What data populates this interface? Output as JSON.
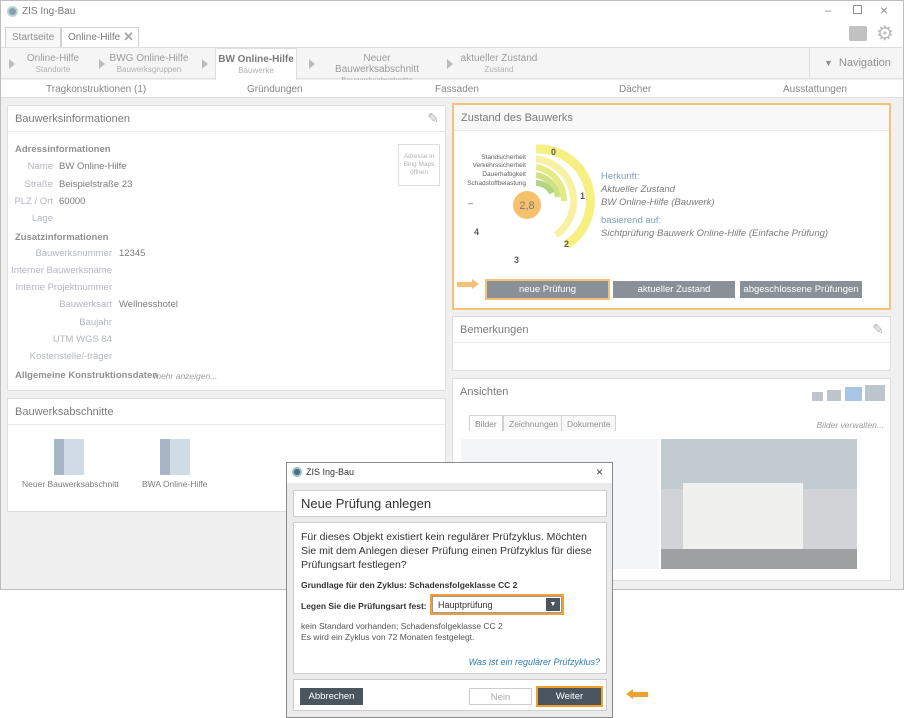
{
  "app": {
    "title": "ZIS Ing-Bau"
  },
  "tabs": [
    "Startseite",
    "Online-Hilfe"
  ],
  "crumbs": [
    {
      "t": "Online-Hilfe",
      "s": "Standorte"
    },
    {
      "t": "BWG Online-Hilfe",
      "s": "Bauwerksgruppen"
    },
    {
      "t": "BW Online-Hilfe",
      "s": "Bauwerke"
    },
    {
      "t": "Neuer Bauwerksabschnitt",
      "s": "Bauwerksabschnitte"
    },
    {
      "t": "aktueller Zustand",
      "s": "Zustand"
    }
  ],
  "navigation": "Navigation",
  "subnav": [
    "Tragkonstruktionen (1)",
    "Gründungen",
    "Fassaden",
    "Dächer",
    "Ausstattungen"
  ],
  "info": {
    "title": "Bauwerksinformationen",
    "addr": "Adressinformationen",
    "name_l": "Name",
    "name_v": "BW Online-Hilfe",
    "str_l": "Straße",
    "str_v": "Beispielstraße 23",
    "plz_l": "PLZ / Ort",
    "plz_v": "60000",
    "lage_l": "Lage",
    "maps": "Adresse in Bing Maps öffnen",
    "zusatz": "Zusatzinformationen",
    "bwn_l": "Bauwerksnummer",
    "bwn_v": "12345",
    "ibn_l": "Interner Bauwerksname",
    "ipn_l": "Interne Projektnummer",
    "art_l": "Bauwerksart",
    "art_v": "Wellnesshotel",
    "bj_l": "Baujahr",
    "utm_l": "UTM WGS 84",
    "kst_l": "Kostenstelle/-träger",
    "allg": "Allgemeine Konstruktionsdaten",
    "mehr": "mehr anzeigen..."
  },
  "abschnitte": {
    "title": "Bauwerksabschnitte",
    "items": [
      "Neuer Bauwerksabschnitt",
      "BWA Online-Hilfe"
    ]
  },
  "zustand": {
    "title": "Zustand des Bauwerks",
    "score": "2,8",
    "arcs": [
      "Standsicherheit",
      "Verkehrssicherheit",
      "Dauerhaftigkeit",
      "Schadstoffbelastung"
    ],
    "ticks": [
      "0",
      "1",
      "2",
      "3",
      "4",
      "–"
    ],
    "herkunft_l": "Herkunft:",
    "herkunft_v1": "Aktueller Zustand",
    "herkunft_v2": "BW Online-Hilfe (Bauwerk)",
    "basis_l": "basierend auf:",
    "basis_v": "Sichtprüfung Bauwerk Online-Hilfe (Einfache Prüfung)",
    "btn1": "neue Prüfung",
    "btn2": "aktueller Zustand",
    "btn3": "abgeschlossene Prüfungen"
  },
  "bemerkungen": {
    "title": "Bemerkungen"
  },
  "ansichten": {
    "title": "Ansichten",
    "tabs": [
      "Bilder",
      "Zeichnungen",
      "Dokumente"
    ],
    "manage": "Bilder verwalten..."
  },
  "dialog": {
    "title": "ZIS Ing-Bau",
    "heading": "Neue Prüfung anlegen",
    "text": "Für dieses Objekt existiert kein regulärer Prüfzyklus. Möchten Sie mit dem Anlegen dieser Prüfung einen Prüfzyklus für diese Prüfungsart festlegen?",
    "grund": "Grundlage für den Zyklus: Schadensfolgeklasse  CC 2",
    "art_l": "Legen Sie die Prüfungsart fest:",
    "art_v": "Hauptprüfung",
    "info1": "kein Standard vorhanden; Schadensfolgeklasse CC 2",
    "info2": "Es wird ein Zyklus von 72 Monaten festgelegt.",
    "link": "Was ist ein regulärer Prüfzyklus?",
    "cancel": "Abbrechen",
    "nein": "Nein",
    "weiter": "Weiter"
  },
  "colors": {
    "accent": "#f0a030",
    "button": "#4a5560",
    "link": "#2a7ab8"
  }
}
